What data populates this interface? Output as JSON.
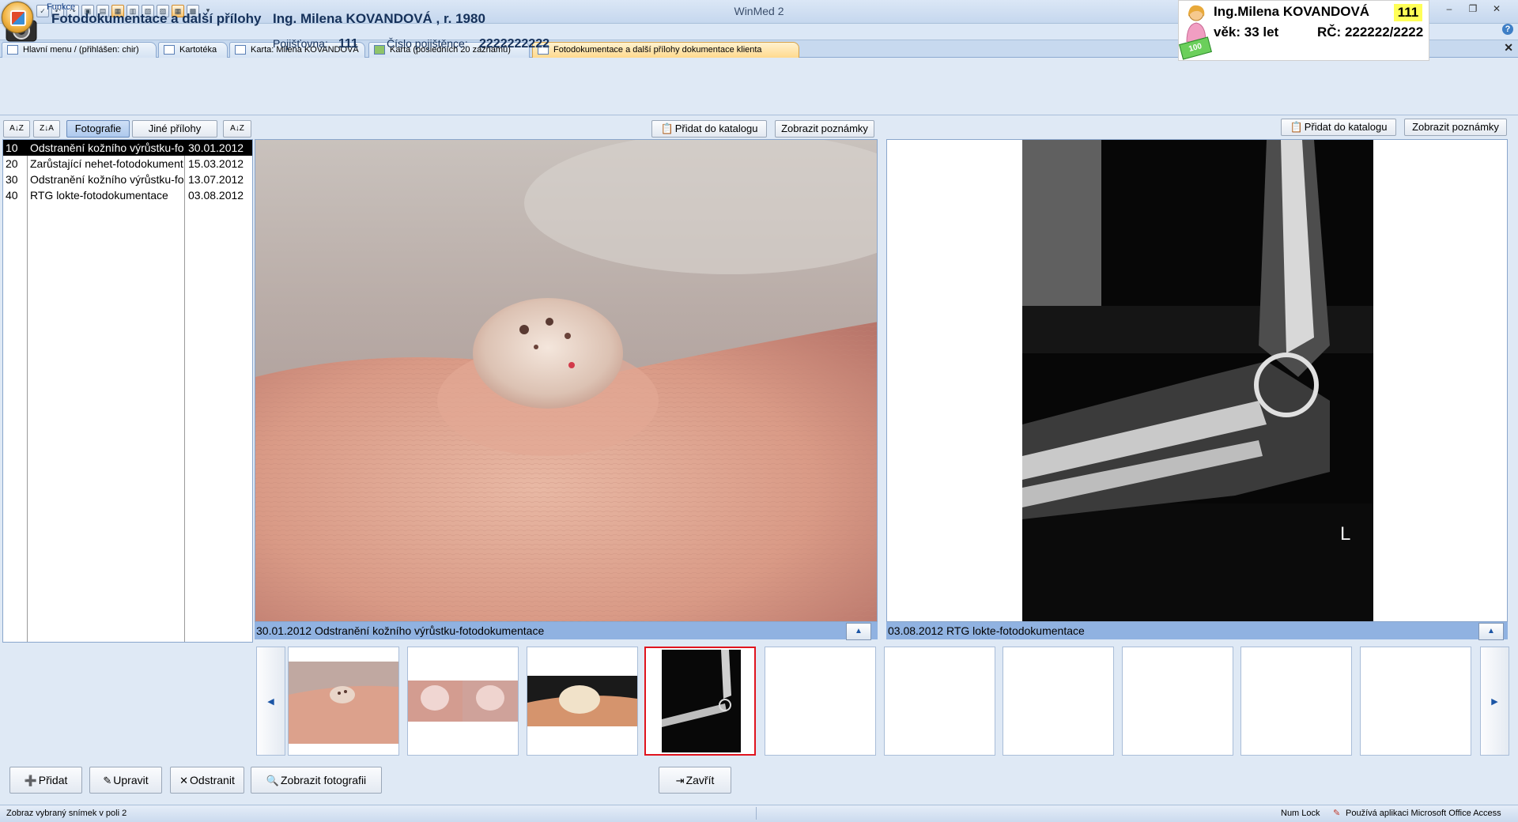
{
  "app": {
    "title": "WinMed 2",
    "ribbon_tab": "Funkce"
  },
  "patient_card": {
    "name": "Ing.Milena KOVANDOVÁ",
    "insurer": "111",
    "age": "věk: 33  let",
    "rc": "RČ: 222222/2222",
    "money": "100"
  },
  "doc_tabs": [
    {
      "label": "Hlavní menu / (přihlášen: chir)"
    },
    {
      "label": "Kartotéka"
    },
    {
      "label": "Karta: Milena KOVANDOVÁ"
    },
    {
      "label": "Karta (posledních 20 záznamů)"
    },
    {
      "label": "Fotodokumentace a další přílohy dokumentace klienta"
    }
  ],
  "header": {
    "title": "Fotodokumentace a další přílohy",
    "patient": "Ing. Milena KOVANDOVÁ , r. 1980",
    "insurer_label": "Pojišťovna:",
    "insurer_value": "111",
    "insured_no_label": "Číslo pojištěnce:",
    "insured_no_value": "2222222222"
  },
  "list_toolbar": {
    "sort_asc": "A↓Z",
    "sort_desc": "Z↓A",
    "tab_photos": "Fotografie",
    "tab_other": "Jiné přílohy",
    "sort_date": "A↓Z"
  },
  "records": [
    {
      "no": "10",
      "name": "Odstranění kožního výrůstku-fotodokumentace",
      "date": "30.01.2012"
    },
    {
      "no": "20",
      "name": "Zarůstající nehet-fotodokumentace",
      "date": "15.03.2012"
    },
    {
      "no": "30",
      "name": "Odstranění kožního výrůstku-fotodokumentace",
      "date": "13.07.2012"
    },
    {
      "no": "40",
      "name": "RTG lokte-fotodokumentace",
      "date": "03.08.2012"
    }
  ],
  "viewer1": {
    "add_catalog": "Přidat do katalogu",
    "show_notes": "Zobrazit poznámky",
    "caption": "30.01.2012 Odstranění kožního výrůstku-fotodokumentace"
  },
  "viewer2": {
    "add_catalog": "Přidat do katalogu",
    "show_notes": "Zobrazit poznámky",
    "caption": "03.08.2012 RTG lokte-fotodokumentace",
    "xray_marker": "L"
  },
  "actions": {
    "add": "Přidat",
    "edit": "Upravit",
    "remove": "Odstranit",
    "show_photo": "Zobrazit fotografii",
    "close": "Zavřít"
  },
  "status": {
    "text": "Zobraz vybraný snímek v poli 2",
    "numlock": "Num Lock",
    "access": "Používá aplikaci Microsoft Office Access"
  }
}
